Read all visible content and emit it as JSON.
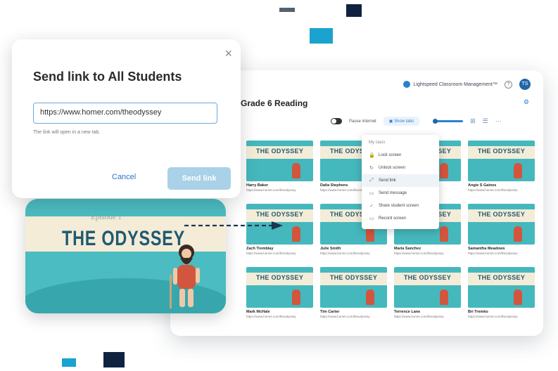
{
  "dialog": {
    "title": "Send link to All Students",
    "url_value": "https://www.homer.com/theodyssey",
    "hint": "The link will open in a new tab.",
    "cancel_label": "Cancel",
    "send_label": "Send link",
    "close_glyph": "×"
  },
  "app": {
    "brand": "Lightspeed Classroom Management™",
    "help_glyph": "?",
    "avatar_initials": "TS",
    "class_title": "Grade 6 Reading",
    "toolbar": {
      "pause_internet": "Pause internet",
      "show_tabs": "Show tabs"
    }
  },
  "menu": {
    "header": "My class",
    "items": [
      {
        "label": "Lock screen",
        "icon": "lock-icon",
        "glyph": "🔒"
      },
      {
        "label": "Unlock screen",
        "icon": "unlock-icon",
        "glyph": "↻"
      },
      {
        "label": "Send link",
        "icon": "link-icon",
        "glyph": "⤢"
      },
      {
        "label": "Send message",
        "icon": "message-icon",
        "glyph": "▭"
      },
      {
        "label": "Share student screen",
        "icon": "share-icon",
        "glyph": "✓"
      },
      {
        "label": "Record screen",
        "icon": "record-icon",
        "glyph": "▭"
      }
    ]
  },
  "tile_title": "THE ODYSSEY",
  "students": [
    {
      "name": "Harry Baker",
      "url": "https://www.homer.com/theodyssey"
    },
    {
      "name": "Dalia Stephens",
      "url": "https://www.homer.com/theodyssey"
    },
    {
      "name": "",
      "url": ""
    },
    {
      "name": "Angie S Gaines",
      "url": "https://www.homer.com/theodyssey"
    },
    {
      "name": "Zach Tremblay",
      "url": "https://www.homer.com/theodyssey"
    },
    {
      "name": "Julie Smith",
      "url": "https://www.homer.com/theodyssey"
    },
    {
      "name": "Maria Sanchez",
      "url": "https://www.homer.com/theodyssey"
    },
    {
      "name": "Samantha Meadows",
      "url": "https://www.homer.com/theodyssey"
    },
    {
      "name": "Mark McHale",
      "url": "https://www.homer.com/theodyssey"
    },
    {
      "name": "Tim Carter",
      "url": "https://www.homer.com/theodyssey"
    },
    {
      "name": "Terrence Lane",
      "url": "https://www.homer.com/theodyssey"
    },
    {
      "name": "Bri Tremko",
      "url": "https://www.homer.com/theodyssey"
    }
  ],
  "big_thumbnail": {
    "episode": "Episode 1",
    "title": "THE ODYSSEY"
  },
  "colors": {
    "teal": "#45b8bd",
    "navy": "#0f2340",
    "accent_blue": "#2d7fd0",
    "send_button": "#a9d1e8"
  }
}
